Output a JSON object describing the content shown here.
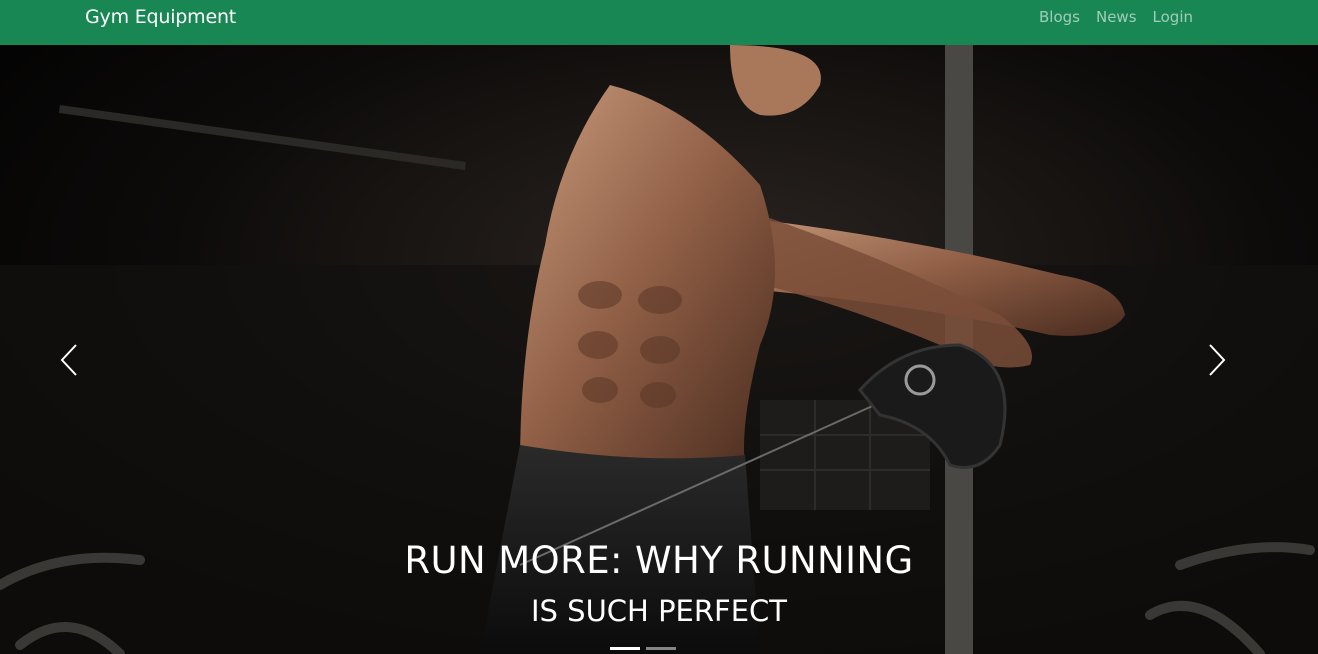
{
  "navbar": {
    "brand": "Gym Equipment",
    "links": [
      {
        "label": "Blogs"
      },
      {
        "label": "News"
      },
      {
        "label": "Login"
      }
    ],
    "color": "#198754"
  },
  "carousel": {
    "caption_title": "RUN MORE: WHY RUNNING",
    "caption_subtitle": "IS SUCH PERFECT",
    "slide_count": 2,
    "active_index": 0,
    "prev_icon": "chevron-left-icon",
    "next_icon": "chevron-right-icon"
  }
}
